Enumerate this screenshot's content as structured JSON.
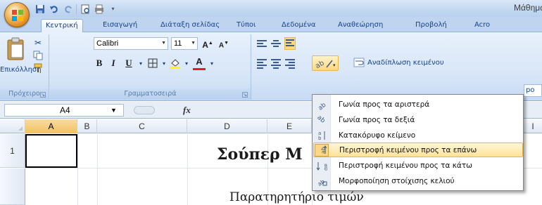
{
  "window": {
    "title": "Μάθημα"
  },
  "tabs": [
    {
      "label": "Κεντρική"
    },
    {
      "label": "Εισαγωγή"
    },
    {
      "label": "Διάταξη σελίδας"
    },
    {
      "label": "Τύποι"
    },
    {
      "label": "Δεδομένα"
    },
    {
      "label": "Αναθεώρηση"
    },
    {
      "label": "Προβολή"
    },
    {
      "label": "Acro"
    }
  ],
  "ribbon": {
    "clipboard": {
      "paste_label": "Επικόλληση",
      "group_label": "Πρόχειρο"
    },
    "font": {
      "font_name": "Calibri",
      "font_size": "11",
      "grow_label": "A",
      "shrink_label": "A",
      "bold": "B",
      "italic": "I",
      "underline": "U",
      "color_label": "A",
      "group_label": "Γραμματοσειρά"
    },
    "alignment": {
      "wrap_text_label": "Αναδίπλωση κειμένου",
      "cut_off_text": "po"
    }
  },
  "formula_bar": {
    "cell_ref": "A4",
    "fx_label": "fx"
  },
  "columns": [
    "A",
    "B",
    "C",
    "D",
    "E",
    "I"
  ],
  "rows": [
    "1"
  ],
  "sheet": {
    "title": "Σούπερ Μ",
    "subtitle": "Παρατηρητήριο τιμών"
  },
  "orientation_menu": {
    "items": [
      {
        "label": "Γωνία προς τα αριστερά",
        "icon": "angle-counterclockwise-icon"
      },
      {
        "label": "Γωνία προς τα δεξιά",
        "icon": "angle-clockwise-icon"
      },
      {
        "label": "Κατακόρυφο κείμενο",
        "icon": "vertical-text-icon"
      },
      {
        "label": "Περιστροφή κειμένου προς τα επάνω",
        "icon": "rotate-up-icon",
        "highlighted": true
      },
      {
        "label": "Περιστροφή κειμένου προς τα κάτω",
        "icon": "rotate-down-icon"
      },
      {
        "label": "Μορφοποίηση στοίχισης κελιού",
        "icon": "format-alignment-icon"
      }
    ]
  },
  "colors": {
    "ribbon_text": "#15428b",
    "highlight": "#ffe39a",
    "selected_column": "#f1c15f"
  }
}
